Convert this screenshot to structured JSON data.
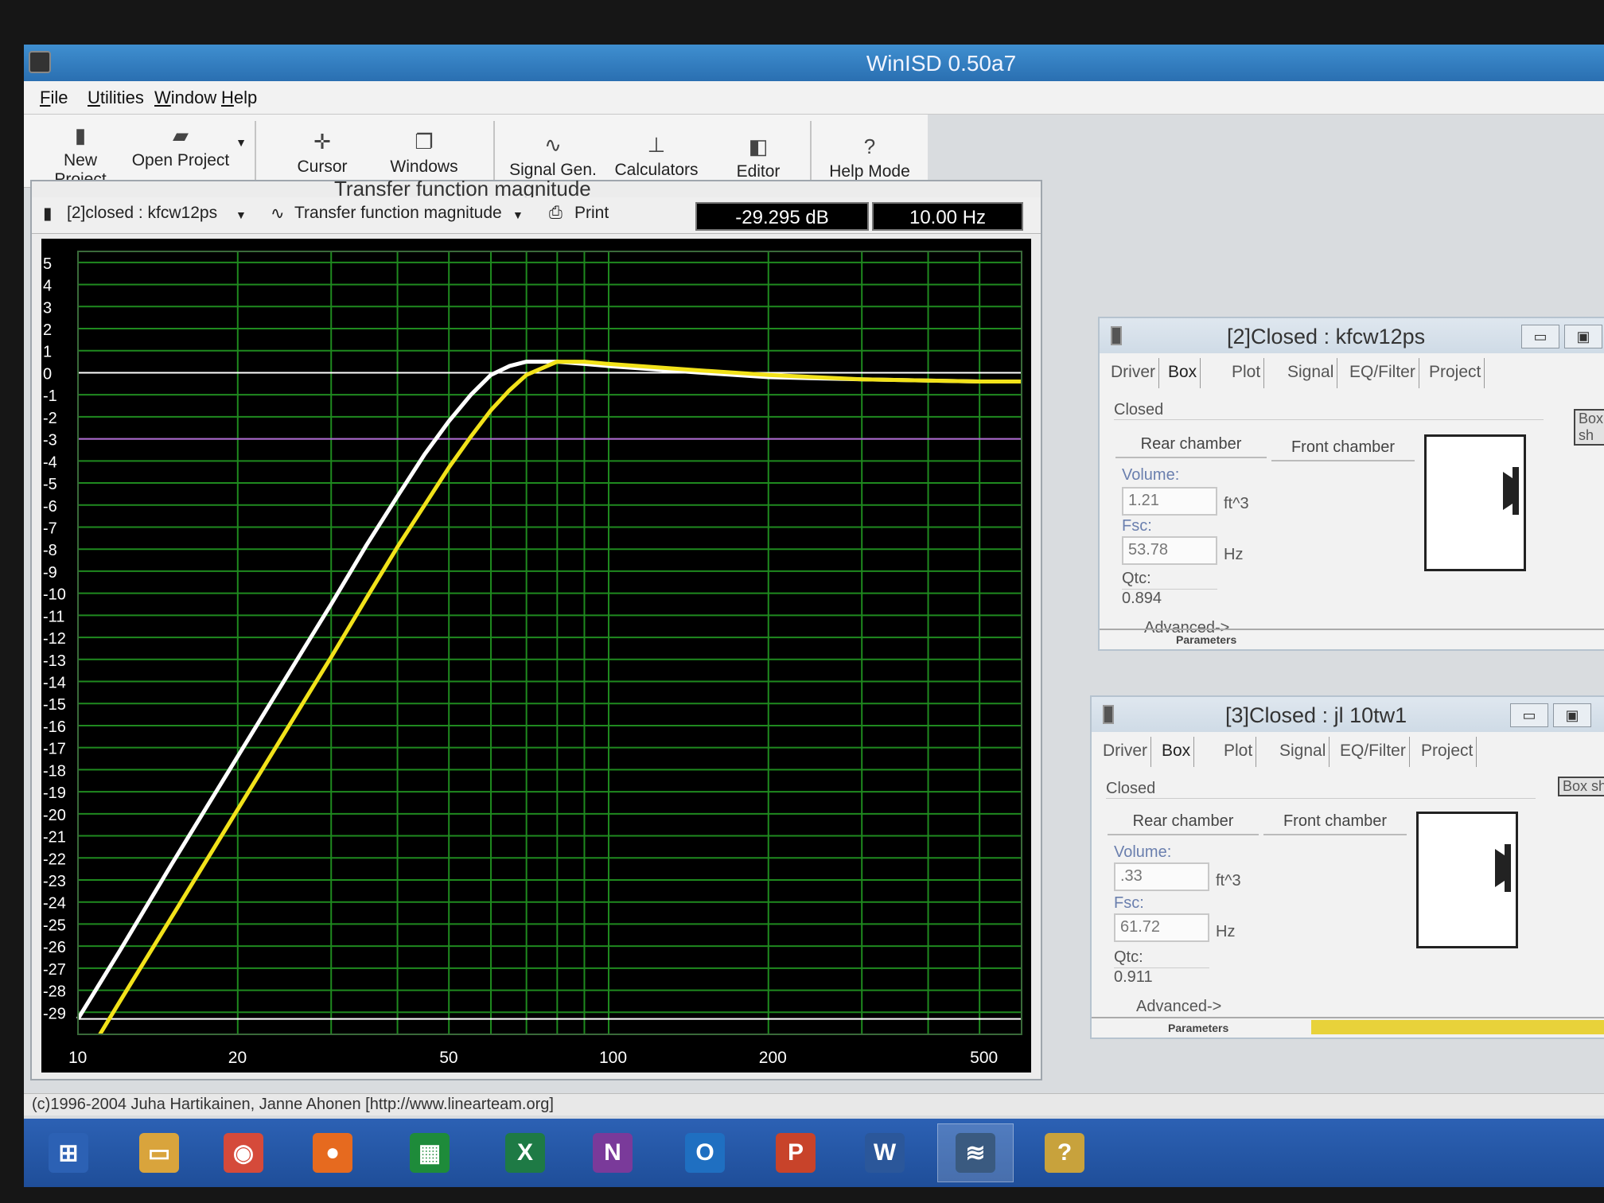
{
  "window": {
    "title": "WinISD 0.50a7"
  },
  "menu": [
    "File",
    "Utilities",
    "Window",
    "Help"
  ],
  "toolbar": {
    "new_project": "New Project",
    "open_project": "Open Project",
    "cursor": "Cursor",
    "windows": "Windows",
    "signal_gen": "Signal Gen.",
    "calculators": "Calculators",
    "editor": "Editor",
    "help_mode": "Help Mode",
    "help_glyph": "?"
  },
  "graph": {
    "window_title": "Transfer function magnitude",
    "project_select": "[2]closed : kfcw12ps",
    "graph_type": "Transfer function magnitude",
    "print": "Print",
    "readout_db": "-29.295 dB",
    "readout_hz": "10.00 Hz"
  },
  "chart_data": {
    "type": "line",
    "title": "",
    "xlabel": "",
    "ylabel": "",
    "x_scale": "log",
    "xlim": [
      10,
      600
    ],
    "ylim": [
      -30,
      5.5
    ],
    "x_ticks": [
      "10",
      "20",
      "50",
      "100",
      "200",
      "500"
    ],
    "y_ticks": [
      "5",
      "4",
      "3",
      "2",
      "1",
      "0",
      "-1",
      "-2",
      "-3",
      "-4",
      "-5",
      "-6",
      "-7",
      "-8",
      "-9",
      "-10",
      "-11",
      "-12",
      "-13",
      "-14",
      "-15",
      "-16",
      "-17",
      "-18",
      "-19",
      "-20",
      "-21",
      "-22",
      "-23",
      "-24",
      "-25",
      "-26",
      "-27",
      "-28",
      "-29"
    ],
    "reference_lines": [
      {
        "y": 0,
        "color": "#ffffff"
      },
      {
        "y": -3,
        "color": "#b266d6"
      },
      {
        "y": -29.3,
        "color": "#ffffff"
      }
    ],
    "grid": true,
    "series": [
      {
        "color": "#ffffff",
        "x": [
          10,
          12,
          15,
          20,
          25,
          30,
          35,
          40,
          45,
          50,
          55,
          60,
          65,
          70,
          80,
          90,
          100,
          150,
          200,
          300,
          500,
          600
        ],
        "y": [
          -29.3,
          -26.2,
          -22.3,
          -17.4,
          -13.6,
          -10.5,
          -7.8,
          -5.6,
          -3.7,
          -2.2,
          -1.0,
          -0.1,
          0.3,
          0.5,
          0.5,
          0.4,
          0.3,
          0.0,
          -0.2,
          -0.3,
          -0.4,
          -0.4
        ]
      },
      {
        "color": "#f2e21a",
        "x": [
          11,
          12,
          15,
          20,
          25,
          30,
          35,
          40,
          45,
          50,
          55,
          60,
          65,
          70,
          80,
          90,
          100,
          150,
          200,
          300,
          500,
          600
        ],
        "y": [
          -30.0,
          -28.5,
          -24.7,
          -19.8,
          -16.0,
          -12.9,
          -10.2,
          -7.9,
          -6.0,
          -4.3,
          -2.9,
          -1.7,
          -0.8,
          -0.1,
          0.5,
          0.5,
          0.4,
          0.1,
          -0.1,
          -0.3,
          -0.4,
          -0.4
        ]
      }
    ]
  },
  "dialogs": [
    {
      "title": "[2]Closed : kfcw12ps",
      "tabs": [
        "Driver",
        "Box",
        "Plot",
        "Signal",
        "EQ/Filter",
        "Project"
      ],
      "box_type": "Closed",
      "box_shape_btn": "Box sh",
      "rear_chamber": "Rear chamber",
      "front_chamber": "Front chamber",
      "volume_label": "Volume:",
      "volume": "1.21",
      "volume_unit": "ft^3",
      "fsc_label": "Fsc:",
      "fsc": "53.78",
      "fsc_unit": "Hz",
      "qtc_label": "Qtc:",
      "qtc": "0.894",
      "advanced": "Advanced->",
      "params": "Parameters",
      "btn_min": "▭",
      "btn_max": "▣"
    },
    {
      "title": "[3]Closed : jl 10tw1",
      "tabs": [
        "Driver",
        "Box",
        "Plot",
        "Signal",
        "EQ/Filter",
        "Project"
      ],
      "box_type": "Closed",
      "box_shape_btn": "Box sha",
      "rear_chamber": "Rear chamber",
      "front_chamber": "Front chamber",
      "volume_label": "Volume:",
      "volume": ".33",
      "volume_unit": "ft^3",
      "fsc_label": "Fsc:",
      "fsc": "61.72",
      "fsc_unit": "Hz",
      "qtc_label": "Qtc:",
      "qtc": "0.911",
      "advanced": "Advanced->",
      "params": "Parameters",
      "btn_min": "▭",
      "btn_max": "▣"
    }
  ],
  "status": {
    "text": "(c)1996-2004 Juha Hartikainen, Janne Ahonen [http://www.linearteam.org]"
  },
  "taskbar": {
    "apps": [
      {
        "name": "start-icon",
        "glyph": "⊞",
        "color": "#2c61b4"
      },
      {
        "name": "file-explorer-icon",
        "glyph": "▭",
        "color": "#d9a43c"
      },
      {
        "name": "chrome-icon",
        "glyph": "◉",
        "color": "#d54a3a"
      },
      {
        "name": "firefox-icon",
        "glyph": "●",
        "color": "#e66a1f"
      },
      {
        "name": "store-icon",
        "glyph": "▦",
        "color": "#1e8b3a"
      },
      {
        "name": "excel-icon",
        "glyph": "X",
        "color": "#1e7a45"
      },
      {
        "name": "onenote-icon",
        "glyph": "N",
        "color": "#7a3a9a"
      },
      {
        "name": "outlook-icon",
        "glyph": "O",
        "color": "#1f6fc1"
      },
      {
        "name": "powerpoint-icon",
        "glyph": "P",
        "color": "#c8432a"
      },
      {
        "name": "word-icon",
        "glyph": "W",
        "color": "#2b579a"
      },
      {
        "name": "winisd-icon",
        "glyph": "≋",
        "color": "#3a5a80"
      },
      {
        "name": "help-icon",
        "glyph": "?",
        "color": "#c8a23c"
      }
    ]
  }
}
